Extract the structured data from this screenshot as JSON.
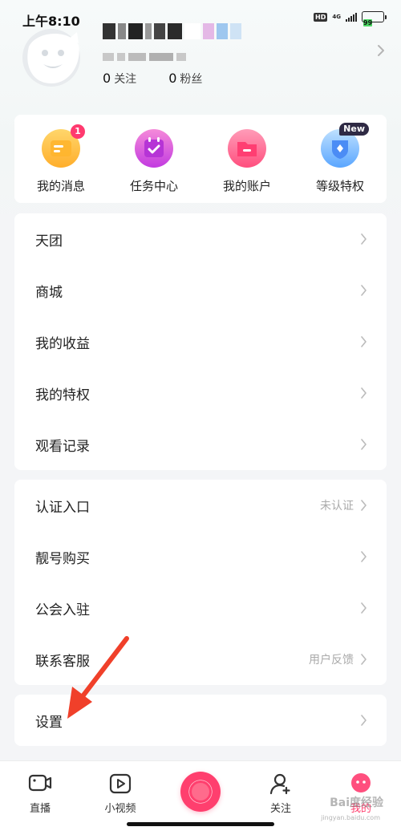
{
  "status_bar": {
    "time": "上午8:10",
    "hd": "HD",
    "network": "4G",
    "battery": "99"
  },
  "profile": {
    "following_count": "0",
    "following_label": "关注",
    "followers_count": "0",
    "followers_label": "粉丝"
  },
  "quick_actions": [
    {
      "label": "我的消息",
      "icon": "message-icon",
      "badge": "1"
    },
    {
      "label": "任务中心",
      "icon": "calendar-check-icon"
    },
    {
      "label": "我的账户",
      "icon": "wallet-folder-icon"
    },
    {
      "label": "等级特权",
      "icon": "diamond-shield-icon",
      "badge": "New"
    }
  ],
  "menu_group_1": [
    {
      "label": "天团"
    },
    {
      "label": "商城"
    },
    {
      "label": "我的收益"
    },
    {
      "label": "我的特权"
    },
    {
      "label": "观看记录"
    }
  ],
  "menu_group_2": [
    {
      "label": "认证入口",
      "value": "未认证"
    },
    {
      "label": "靓号购买"
    },
    {
      "label": "公会入驻"
    },
    {
      "label": "联系客服",
      "value": "用户反馈"
    }
  ],
  "menu_group_3": [
    {
      "label": "设置"
    }
  ],
  "bottom_nav": [
    {
      "label": "直播",
      "icon": "live-camera-icon"
    },
    {
      "label": "小视频",
      "icon": "play-video-icon"
    },
    {
      "label": "",
      "icon": "record-icon"
    },
    {
      "label": "关注",
      "icon": "add-person-icon"
    },
    {
      "label": "我的",
      "icon": "mine-face-icon"
    }
  ],
  "watermark": {
    "main": "Bai度经验",
    "sub": "jingyan.baidu.com"
  },
  "colors": {
    "accent": "#ff3f6e",
    "arrow": "#f0402a"
  }
}
